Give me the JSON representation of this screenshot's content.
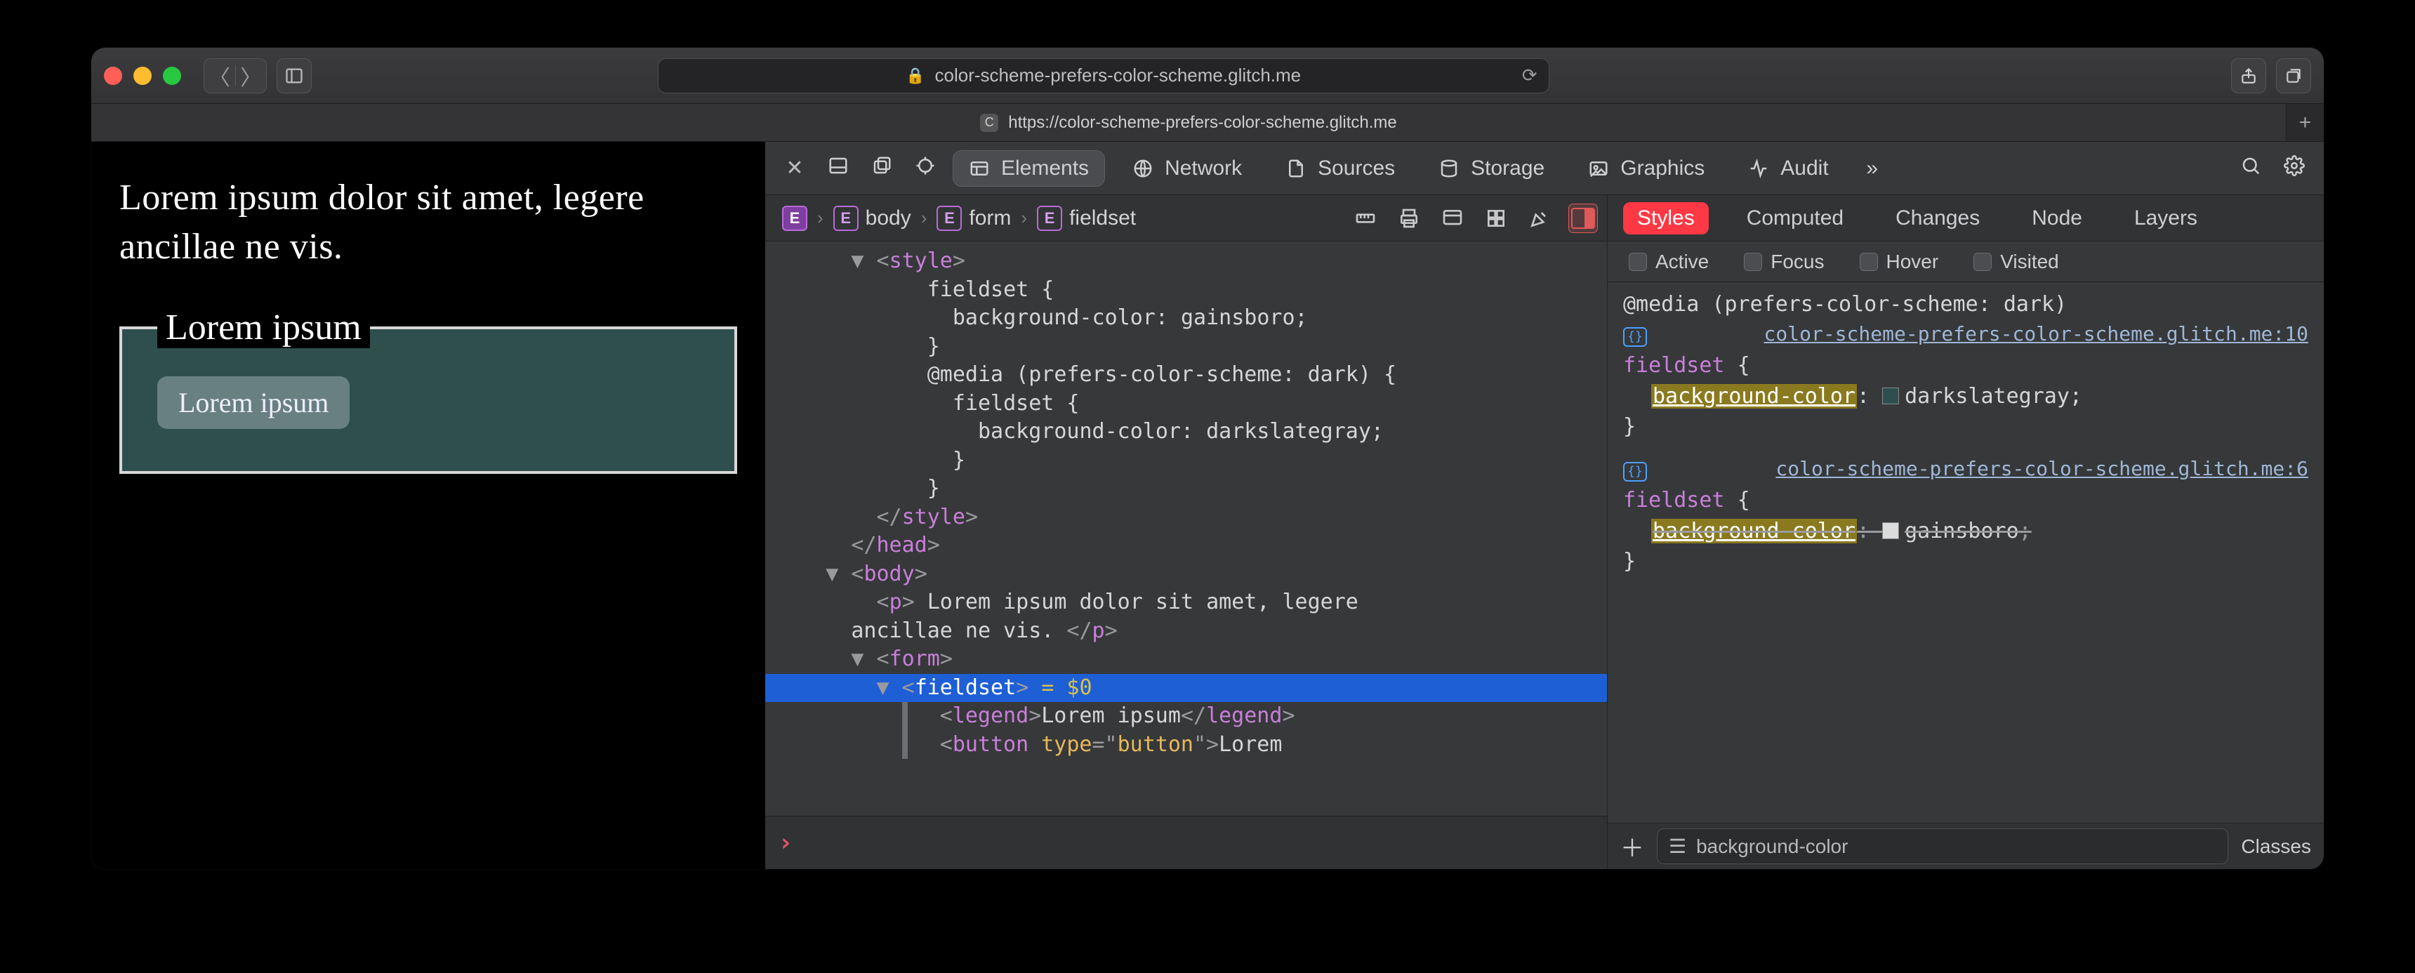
{
  "browser": {
    "address_text": "color-scheme-prefers-color-scheme.glitch.me",
    "tab": {
      "favicon_letter": "C",
      "title": "https://color-scheme-prefers-color-scheme.glitch.me"
    }
  },
  "page": {
    "paragraph": "Lorem ipsum dolor sit amet, legere ancillae ne vis.",
    "legend": "Lorem ipsum",
    "button": "Lorem ipsum"
  },
  "devtools": {
    "tabs": {
      "elements": "Elements",
      "network": "Network",
      "sources": "Sources",
      "storage": "Storage",
      "graphics": "Graphics",
      "audit": "Audit"
    },
    "breadcrumbs": [
      "",
      "body",
      "form",
      "fieldset"
    ],
    "dom_lines": [
      {
        "indent": 3,
        "tri": "▼",
        "html": "<span class='tk-punc'>&lt;</span><span class='tk-tag'>style</span><span class='tk-punc'>&gt;</span>"
      },
      {
        "indent": 5,
        "html": "<span class='tk-text'>fieldset {</span>"
      },
      {
        "indent": 6,
        "html": "<span class='tk-text'>background-color: gainsboro;</span>"
      },
      {
        "indent": 5,
        "html": "<span class='tk-text'>}</span>"
      },
      {
        "indent": 5,
        "html": "<span class='tk-text'>@media (prefers-color-scheme: dark) {</span>"
      },
      {
        "indent": 6,
        "html": "<span class='tk-text'>fieldset {</span>"
      },
      {
        "indent": 7,
        "html": "<span class='tk-text'>background-color: darkslategray;</span>"
      },
      {
        "indent": 6,
        "html": "<span class='tk-text'>}</span>"
      },
      {
        "indent": 5,
        "html": "<span class='tk-text'>}</span>"
      },
      {
        "indent": 3,
        "html": "<span class='tk-punc'>&lt;/</span><span class='tk-tag'>style</span><span class='tk-punc'>&gt;</span>"
      },
      {
        "indent": 2,
        "html": "<span class='tk-punc'>&lt;/</span><span class='tk-tag'>head</span><span class='tk-punc'>&gt;</span>"
      },
      {
        "indent": 2,
        "tri": "▼",
        "html": "<span class='tk-punc'>&lt;</span><span class='tk-tag'>body</span><span class='tk-punc'>&gt;</span>"
      },
      {
        "indent": 3,
        "html": "<span class='tk-punc'>&lt;</span><span class='tk-tag'>p</span><span class='tk-punc'>&gt;</span><span class='tk-text'> Lorem ipsum dolor sit amet, legere </span>"
      },
      {
        "indent": 3,
        "cont": true,
        "html": "<span class='tk-text'>ancillae ne vis. </span><span class='tk-punc'>&lt;/</span><span class='tk-tag'>p</span><span class='tk-punc'>&gt;</span>"
      },
      {
        "indent": 3,
        "tri": "▼",
        "html": "<span class='tk-punc'>&lt;</span><span class='tk-tag'>form</span><span class='tk-punc'>&gt;</span>"
      },
      {
        "indent": 4,
        "tri": "▼",
        "sel": true,
        "html": "<span class='tk-punc'>&lt;</span><span class='tk-tag'>fieldset</span><span class='tk-punc'>&gt;</span> <span class='eq0'>= $0</span>"
      },
      {
        "indent": 5,
        "gut": true,
        "html": "<span class='tk-punc'>&lt;</span><span class='tk-tag'>legend</span><span class='tk-punc'>&gt;</span><span class='tk-text'>Lorem ipsum</span><span class='tk-punc'>&lt;/</span><span class='tk-tag'>legend</span><span class='tk-punc'>&gt;</span>"
      },
      {
        "indent": 5,
        "gut": true,
        "html": "<span class='tk-punc'>&lt;</span><span class='tk-tag'>button</span> <span class='tk-attr'>type</span><span class='tk-punc'>=&quot;</span><span class='tk-str'>button</span><span class='tk-punc'>&quot;&gt;</span><span class='tk-text'>Lorem </span>"
      }
    ],
    "styles": {
      "tabs": {
        "styles": "Styles",
        "computed": "Computed",
        "changes": "Changes",
        "node": "Node",
        "layers": "Layers"
      },
      "pseudo": {
        "active": "Active",
        "focus": "Focus",
        "hover": "Hover",
        "visited": "Visited"
      },
      "media_query": "@media (prefers-color-scheme: dark)",
      "rules": [
        {
          "source": "color-scheme-prefers-color-scheme.glitch.me:10",
          "selector": "fieldset",
          "props": [
            {
              "name": "background-color",
              "value": "darkslategray",
              "swatch": "#2f4f4f",
              "overridden": false
            }
          ]
        },
        {
          "source": "color-scheme-prefers-color-scheme.glitch.me:6",
          "selector": "fieldset",
          "props": [
            {
              "name": "background-color",
              "value": "gainsboro",
              "swatch": "#dcdcdc",
              "overridden": true
            }
          ]
        }
      ],
      "filter_value": "background-color",
      "classes_label": "Classes"
    }
  }
}
